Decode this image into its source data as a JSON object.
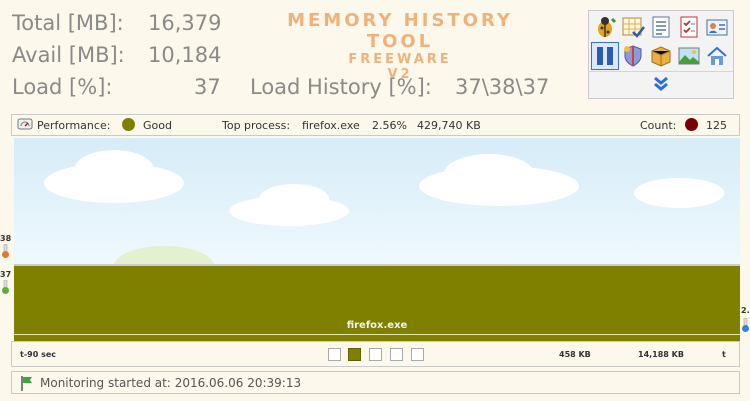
{
  "stats": {
    "total_label": "Total [MB]:",
    "total_value": "16,379",
    "avail_label": "Avail [MB]:",
    "avail_value": "10,184",
    "load_label": "Load [%]:",
    "load_value": "37",
    "history_label": "Load History [%]:",
    "history_value": "37\\38\\37"
  },
  "logo": {
    "line1": "MEMORY HISTORY TOOL",
    "line2": "FREEWARE",
    "line3": "V2"
  },
  "toolbar": {
    "icons": [
      "bug-icon",
      "table-check-icon",
      "document-list-icon",
      "checklist-icon",
      "contact-card-icon",
      "pause-icon",
      "shield-icon",
      "package-icon",
      "picture-icon",
      "home-icon"
    ],
    "more_icon": "double-chevron-down-icon"
  },
  "performance": {
    "label": "Performance:",
    "status": "Good",
    "status_color": "#808000",
    "top_process_label": "Top process:",
    "top_process_name": "firefox.exe",
    "top_process_percent": "2.56%",
    "top_process_mem": "429,740 KB",
    "count_label": "Count:",
    "count_value": "125",
    "count_color": "#7a0000"
  },
  "graph": {
    "process_label": "firefox.exe",
    "left_high": "38",
    "left_low": "37",
    "right_value": "2."
  },
  "timeline": {
    "start_label": "t-90 sec",
    "value_1": "458 KB",
    "value_2": "14,188 KB",
    "end_label": "t",
    "selected_page": 2
  },
  "status": {
    "label": "Monitoring started at:",
    "timestamp": "2016.06.06 20:39:13"
  }
}
